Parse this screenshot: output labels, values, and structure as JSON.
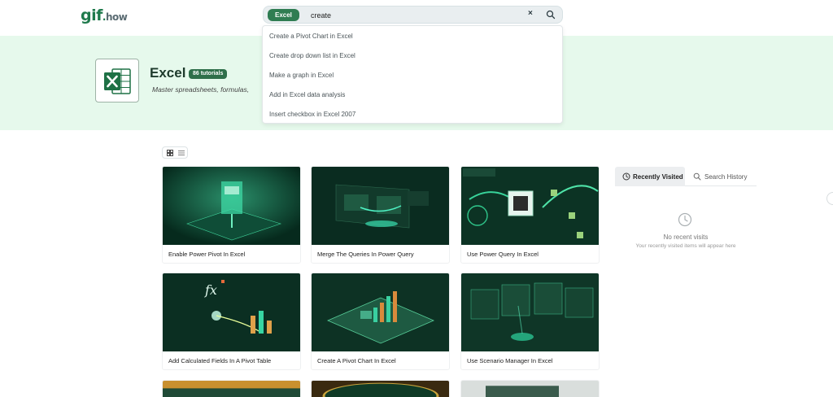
{
  "header": {
    "logo_main": "gif",
    "logo_dot": ".",
    "logo_suffix": "how"
  },
  "search": {
    "chip_label": "Excel",
    "query": "create",
    "clear_glyph": "×",
    "suggestions": [
      "Create a Pivot Chart in Excel",
      "Create drop down list in Excel",
      "Make a graph in Excel",
      "Add in Excel data analysis",
      "Insert checkbox in Excel 2007"
    ]
  },
  "hero": {
    "title": "Excel",
    "badge": "86 tutorials",
    "subtitle": "Master spreadsheets, formulas,",
    "icon": "excel-logo-icon"
  },
  "cards": [
    {
      "title": "Enable Power Pivot In Excel"
    },
    {
      "title": "Merge The Queries In Power Query"
    },
    {
      "title": "Use Power Query In Excel"
    },
    {
      "title": "Add Calculated Fields In A Pivot Table"
    },
    {
      "title": "Create A Pivot Chart In Excel"
    },
    {
      "title": "Use Scenario Manager In Excel"
    }
  ],
  "sidebar": {
    "tabs": [
      {
        "label": "Recently Visited",
        "icon": "clock-icon",
        "active": true
      },
      {
        "label": "Search History",
        "icon": "search-icon",
        "active": false
      }
    ],
    "empty_title": "No recent visits",
    "empty_subtitle": "Your recently visited items will appear here"
  },
  "colors": {
    "brand": "#1f7a4c",
    "hero_bg": "#e6f9ec",
    "chip": "#2f7d52"
  }
}
